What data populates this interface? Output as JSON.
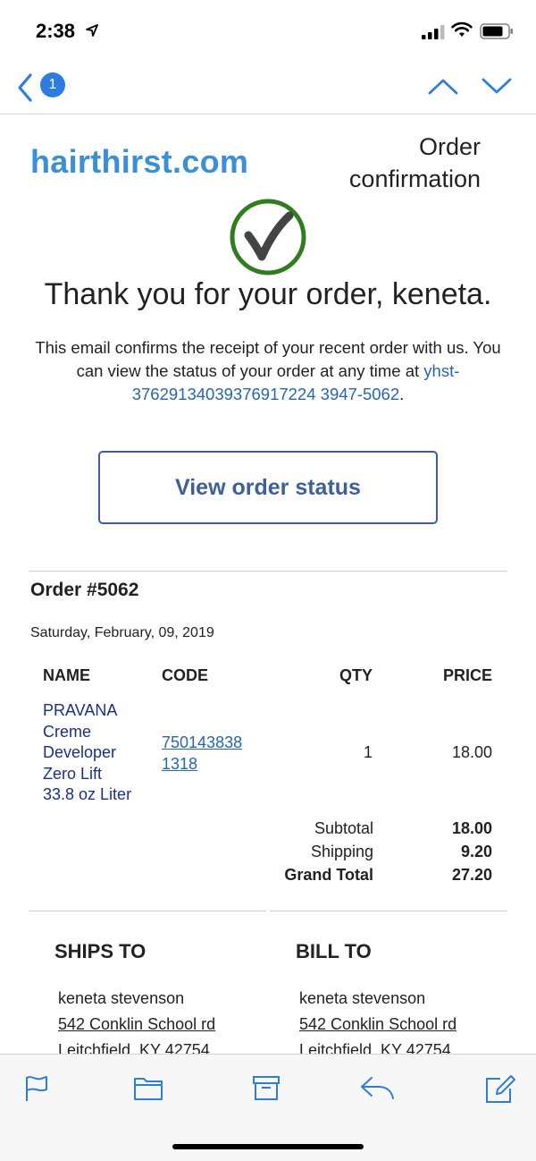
{
  "status": {
    "time": "2:38"
  },
  "nav": {
    "unread_count": "1"
  },
  "email": {
    "brand": "hairthirst.com",
    "heading": "Order confirmation",
    "thanks": "Thank you for your order, keneta.",
    "confirm_text": "This email confirms the receipt of your recent order with us. You can view the status of your order at any time at",
    "confirm_link": "yhst-37629134039376917224 3947-5062",
    "confirm_end": ".",
    "button": "View order status"
  },
  "order": {
    "number": "Order #5062",
    "date": "Saturday, February, 09, 2019",
    "columns": [
      "NAME",
      "CODE",
      "QTY",
      "PRICE"
    ],
    "items": [
      {
        "name_lines": [
          "PRAVANA",
          "Creme",
          "Developer",
          "Zero Lift",
          "33.8 oz Liter"
        ],
        "code_lines": [
          "750143838",
          "1318"
        ],
        "qty": "1",
        "price": "18.00"
      }
    ],
    "totals": [
      {
        "label": "Subtotal",
        "value": "18.00"
      },
      {
        "label": "Shipping",
        "value": "9.20"
      },
      {
        "label": "Grand Total",
        "value": "27.20"
      }
    ]
  },
  "ship_to": {
    "title": "SHIPS TO",
    "name": "keneta stevenson",
    "street": "542 Conklin School rd",
    "city": "Leitchfield, KY 42754"
  },
  "bill_to": {
    "title": "BILL TO",
    "name": "keneta stevenson",
    "street": "542 Conklin School rd",
    "city": "Leitchfield, KY 42754"
  },
  "toolbar": {
    "icons": [
      "flag-icon",
      "folder-icon",
      "archive-icon",
      "reply-icon",
      "compose-icon"
    ]
  },
  "colors": {
    "accent": "#2d7de0",
    "brand": "#3a8fd9",
    "button": "#3d5f9b",
    "check": "#2f7d1e"
  }
}
